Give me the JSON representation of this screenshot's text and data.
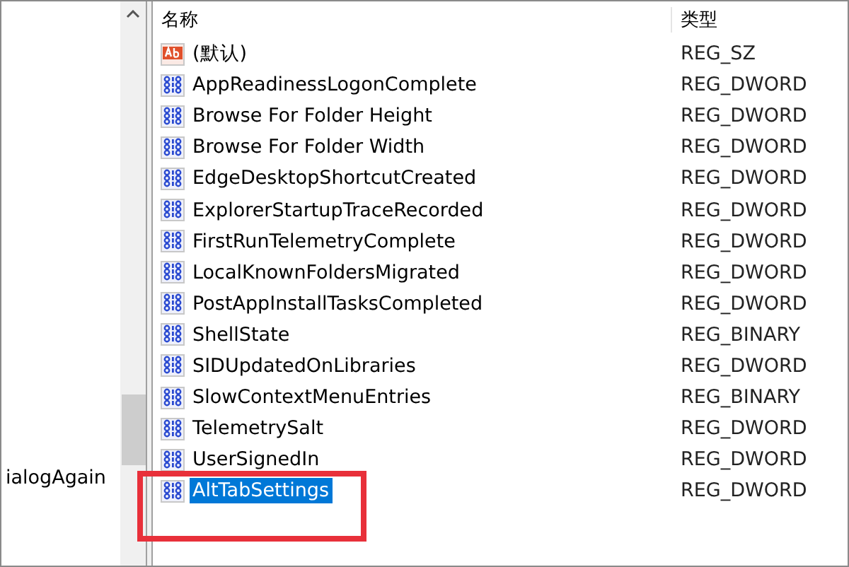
{
  "tree_pane": {
    "items": [
      {
        "label": "ialogAgain",
        "selected": false
      }
    ]
  },
  "list": {
    "columns": [
      "名称",
      "类型"
    ],
    "rows": [
      {
        "name": "(默认)",
        "type": "REG_SZ",
        "kind": "string",
        "selected": false
      },
      {
        "name": "AppReadinessLogonComplete",
        "type": "REG_DWORD",
        "kind": "binary",
        "selected": false
      },
      {
        "name": "Browse For Folder Height",
        "type": "REG_DWORD",
        "kind": "binary",
        "selected": false
      },
      {
        "name": "Browse For Folder Width",
        "type": "REG_DWORD",
        "kind": "binary",
        "selected": false
      },
      {
        "name": "EdgeDesktopShortcutCreated",
        "type": "REG_DWORD",
        "kind": "binary",
        "selected": false
      },
      {
        "name": "ExplorerStartupTraceRecorded",
        "type": "REG_DWORD",
        "kind": "binary",
        "selected": false
      },
      {
        "name": "FirstRunTelemetryComplete",
        "type": "REG_DWORD",
        "kind": "binary",
        "selected": false
      },
      {
        "name": "LocalKnownFoldersMigrated",
        "type": "REG_DWORD",
        "kind": "binary",
        "selected": false
      },
      {
        "name": "PostAppInstallTasksCompleted",
        "type": "REG_DWORD",
        "kind": "binary",
        "selected": false
      },
      {
        "name": "ShellState",
        "type": "REG_BINARY",
        "kind": "binary",
        "selected": false
      },
      {
        "name": "SIDUpdatedOnLibraries",
        "type": "REG_DWORD",
        "kind": "binary",
        "selected": false
      },
      {
        "name": "SlowContextMenuEntries",
        "type": "REG_BINARY",
        "kind": "binary",
        "selected": false
      },
      {
        "name": "TelemetrySalt",
        "type": "REG_DWORD",
        "kind": "binary",
        "selected": false
      },
      {
        "name": "UserSignedIn",
        "type": "REG_DWORD",
        "kind": "binary",
        "selected": false
      },
      {
        "name": "AltTabSettings",
        "type": "REG_DWORD",
        "kind": "binary",
        "selected": true
      }
    ]
  }
}
